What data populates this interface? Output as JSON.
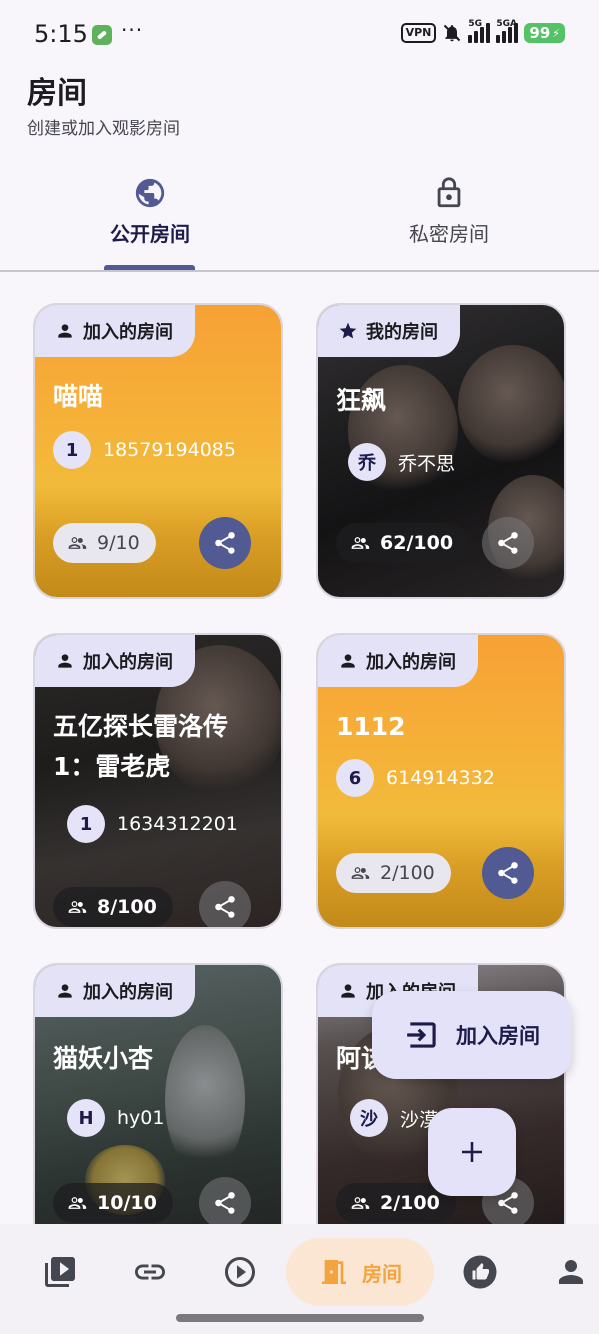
{
  "status_bar": {
    "time": "5:15",
    "dots": "···",
    "vpn": "VPN",
    "signal1": "5G",
    "signal2": "5GA",
    "battery": "99"
  },
  "header": {
    "title": "房间",
    "subtitle": "创建或加入观影房间"
  },
  "tabs": [
    {
      "label": "公开房间",
      "icon": "globe-icon",
      "selected": true
    },
    {
      "label": "私密房间",
      "icon": "lock-icon",
      "selected": false
    }
  ],
  "rooms": [
    {
      "tag": "加入的房间",
      "tag_icon": "person-icon",
      "name": "喵喵",
      "owner_avatar": "1",
      "owner_name": "18579194085",
      "count": "9/10",
      "accent": "#515a92"
    },
    {
      "tag": "我的房间",
      "tag_icon": "star-icon",
      "name": "狂飙",
      "owner_avatar": "乔",
      "owner_name": "乔不思",
      "count": "62/100"
    },
    {
      "tag": "加入的房间",
      "tag_icon": "person-icon",
      "name_line1": "五亿探长雷洛传",
      "name_line2": "1：雷老虎",
      "owner_avatar": "1",
      "owner_name": "1634312201",
      "count": "8/100"
    },
    {
      "tag": "加入的房间",
      "tag_icon": "person-icon",
      "name": "1112",
      "owner_avatar": "6",
      "owner_name": "614914332",
      "count": "2/100"
    },
    {
      "tag": "加入的房间",
      "tag_icon": "person-icon",
      "name": "猫妖小杏",
      "owner_avatar": "H",
      "owner_name": "hy01",
      "count": "10/10"
    },
    {
      "tag": "加入的房间",
      "tag_icon": "person-icon",
      "name": "阿该",
      "owner_avatar": "沙",
      "owner_name": "沙漠",
      "count": "2/100"
    }
  ],
  "fab": {
    "join_label": "加入房间",
    "join_icon": "login-icon",
    "add_icon": "plus-icon"
  },
  "bottom_nav": [
    {
      "icon": "video-library-icon"
    },
    {
      "icon": "link-icon"
    },
    {
      "icon": "play-circle-icon"
    },
    {
      "icon": "door-icon",
      "label": "房间",
      "active": true
    },
    {
      "icon": "thumb-up-icon"
    },
    {
      "icon": "person-icon"
    }
  ],
  "colors": {
    "primary": "#515a92",
    "tag_bg": "#e3e2f6",
    "active_nav": "#f3a43f"
  }
}
